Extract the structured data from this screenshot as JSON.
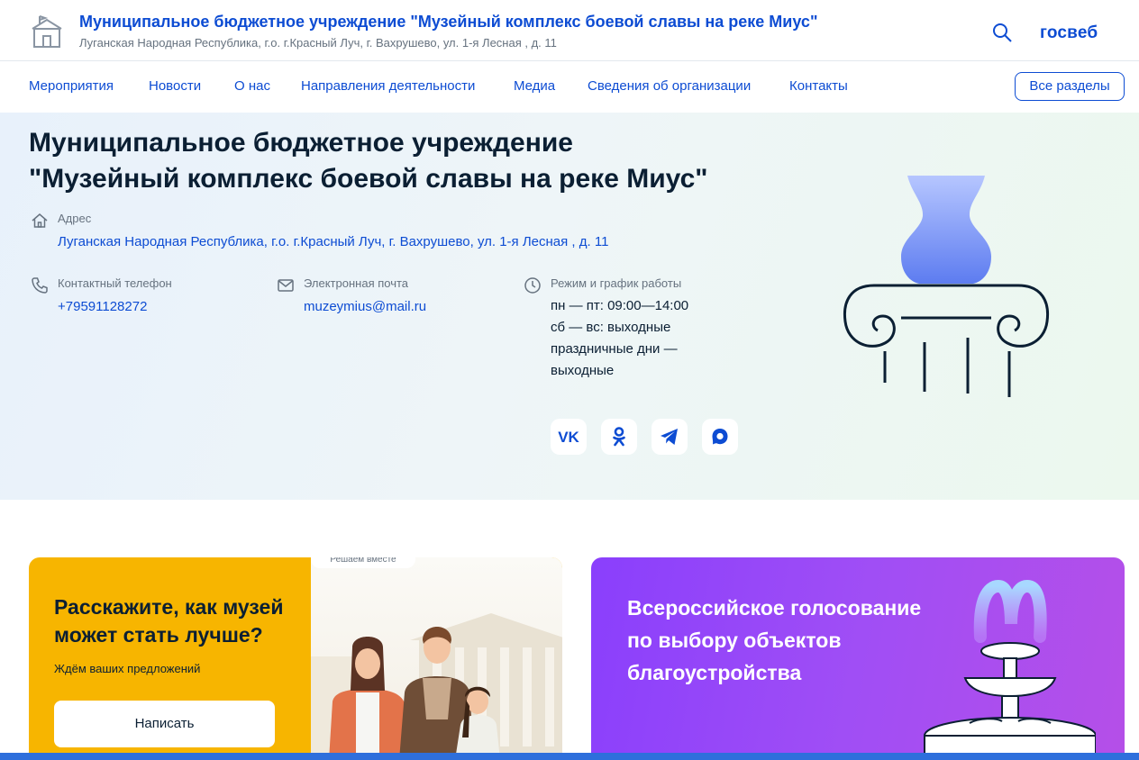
{
  "header": {
    "title": "Муниципальное бюджетное учреждение \"Музейный комплекс боевой славы на реке Миус\"",
    "address": "Луганская Народная Республика, г.о. г.Красный Луч, г. Вахрушево, ул. 1-я Лесная , д. 11",
    "brand": "госвеб",
    "search_icon": "search-icon",
    "logo_icon": "building-icon"
  },
  "nav": {
    "items": [
      "Мероприятия",
      "Новости",
      "О нас",
      "Направления деятельности",
      "Медиа",
      "Сведения об организации",
      "Контакты"
    ],
    "all_sections": "Все разделы"
  },
  "hero": {
    "title_line1": "Муниципальное бюджетное учреждение",
    "title_line2": "\"Музейный комплекс боевой славы на реке Миус\"",
    "address_label": "Адрес",
    "address_value": "Луганская Народная Республика, г.о. г.Красный Луч, г. Вахрушево, ул. 1-я Лесная , д. 11",
    "phone_label": "Контактный телефон",
    "phone_value": "+79591128272",
    "email_label": "Электронная почта",
    "email_value": "muzeymius@mail.ru",
    "schedule_label": "Режим и график работы",
    "schedule_lines": [
      "пн — пт: 09:00—14:00",
      "сб — вс: выходные",
      "праздничные дни —",
      "выходные"
    ],
    "socials": [
      "vk-icon",
      "ok-icon",
      "telegram-icon",
      "max-icon"
    ]
  },
  "cards": {
    "left": {
      "title_line1": "Расскажите, как музей",
      "title_line2": "может стать лучше?",
      "subtitle": "Ждём ваших предложений",
      "button": "Написать",
      "badge": "Решаем вместе"
    },
    "right": {
      "title_line1": "Всероссийское голосование",
      "title_line2": "по выбору объектов",
      "title_line3": "благоустройства"
    }
  },
  "colors": {
    "accent": "#0d4cd3",
    "text": "#0b1f33",
    "muted": "#66727f",
    "card_yellow": "#f7b500",
    "card_purple": "#9b45f5"
  }
}
